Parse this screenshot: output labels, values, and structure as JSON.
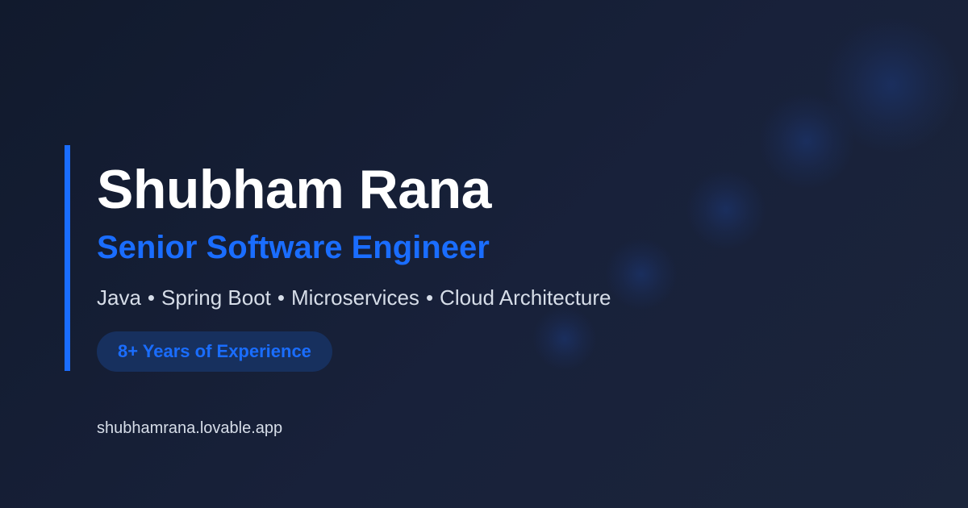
{
  "profile": {
    "name": "Shubham Rana",
    "role": "Senior Software Engineer",
    "skills": [
      "Java",
      "Spring Boot",
      "Microservices",
      "Cloud Architecture"
    ],
    "skills_separator": "•",
    "experience_badge": "8+ Years of Experience",
    "url": "shubhamrana.lovable.app"
  },
  "colors": {
    "background": "#141c30",
    "accent": "#1a6dff",
    "name_text": "#ffffff",
    "secondary_text": "#d6dde8",
    "badge_background": "#17305e"
  }
}
